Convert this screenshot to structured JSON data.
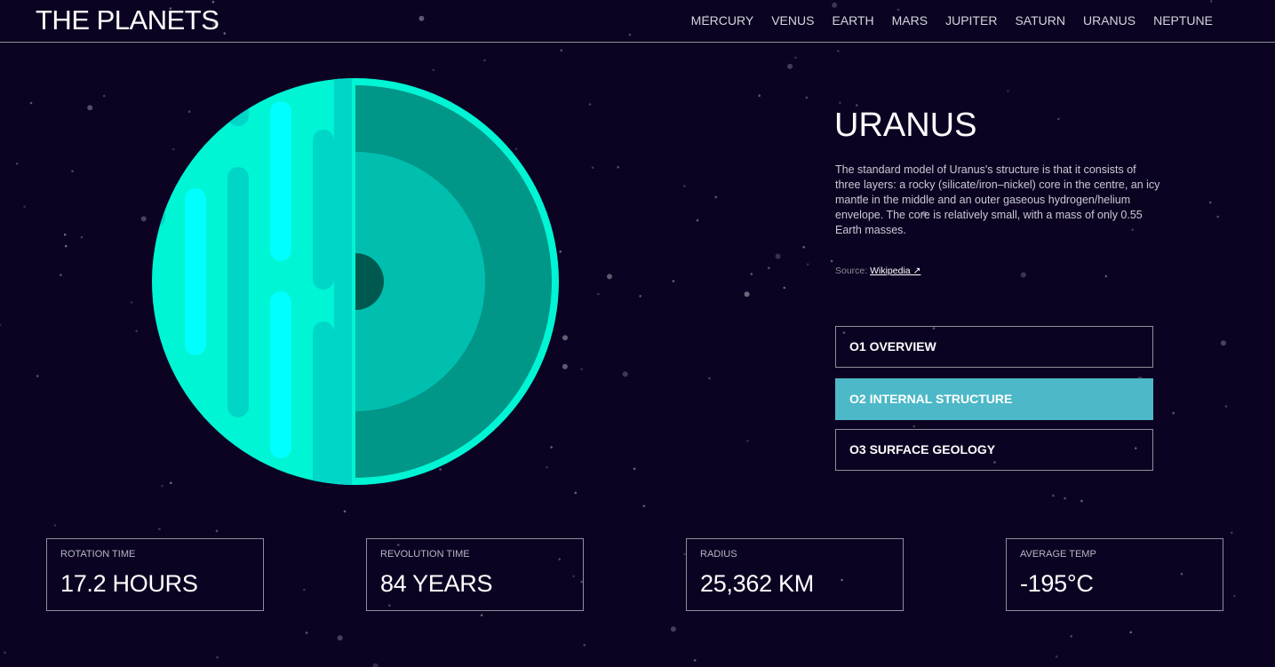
{
  "header": {
    "brand": "THE PLANETS",
    "nav": [
      "MERCURY",
      "VENUS",
      "EARTH",
      "MARS",
      "JUPITER",
      "SATURN",
      "URANUS",
      "NEPTUNE"
    ]
  },
  "planet": {
    "name": "URANUS",
    "description": "The standard model of Uranus's structure is that it consists of three layers: a rocky (silicate/iron–nickel) core in the centre, an icy mantle in the middle and an outer gaseous hydrogen/helium envelope. The core is relatively small, with a mass of only 0.55 Earth masses.",
    "source_label": "Source: ",
    "source_link": "Wikipedia",
    "source_icon": "external-link-icon",
    "source_arrow": "↗"
  },
  "tabs": [
    {
      "label": "O1 OVERVIEW",
      "active": false
    },
    {
      "label": "O2 INTERNAL STRUCTURE",
      "active": true
    },
    {
      "label": "O3 SURFACE GEOLOGY",
      "active": false
    }
  ],
  "stats": [
    {
      "label": "ROTATION TIME",
      "value": "17.2 HOURS"
    },
    {
      "label": "REVOLUTION TIME",
      "value": "84 YEARS"
    },
    {
      "label": "RADIUS",
      "value": "25,362 KM"
    },
    {
      "label": "AVERAGE TEMP",
      "value": "-195°C"
    }
  ],
  "colors": {
    "background": "#0c0322",
    "active_tab": "#4db8c8",
    "planet_surface": "#00f5d4",
    "planet_envelope": "#009688",
    "planet_mantle": "#00bfae",
    "planet_core": "#00594f",
    "stripe": "#00ffff"
  }
}
